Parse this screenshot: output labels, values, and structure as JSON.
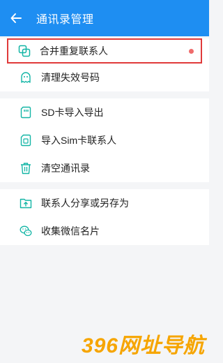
{
  "header": {
    "title": "通讯录管理",
    "back_icon": "arrow-left-icon",
    "bg_color": "#1e8ef2"
  },
  "groups": [
    {
      "items": [
        {
          "label": "合并重复联系人",
          "icon": "merge-contacts-icon",
          "badge": true,
          "highlighted": true
        },
        {
          "label": "清理失效号码",
          "icon": "ghost-icon"
        }
      ]
    },
    {
      "items": [
        {
          "label": "SD卡导入导出",
          "icon": "sd-card-icon"
        },
        {
          "label": "导入Sim卡联系人",
          "icon": "sim-card-icon"
        },
        {
          "label": "清空通讯录",
          "icon": "trash-icon"
        }
      ]
    },
    {
      "items": [
        {
          "label": "联系人分享或另存为",
          "icon": "share-folder-icon"
        },
        {
          "label": "收集微信名片",
          "icon": "wechat-icon"
        }
      ]
    }
  ],
  "watermark": "396网址导航",
  "colors": {
    "accent": "#1e8ef2",
    "highlight_border": "#e03a3a",
    "badge_dot": "#ef6b6b"
  }
}
